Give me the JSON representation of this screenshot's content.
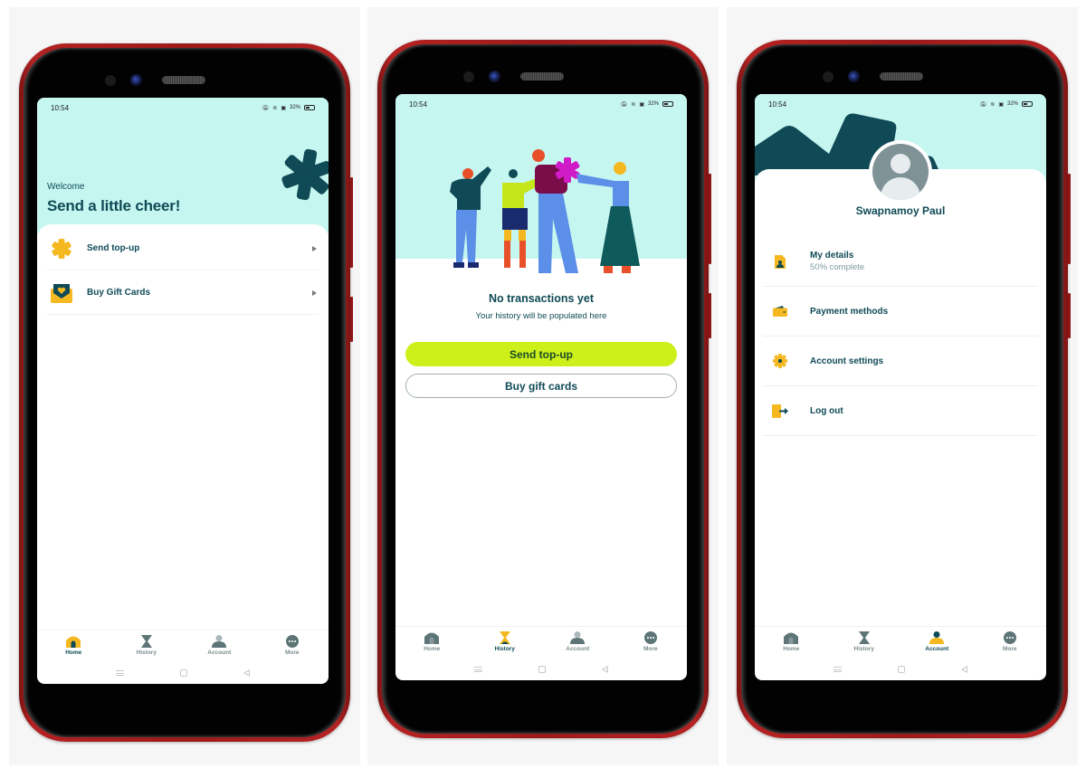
{
  "status_bar": {
    "time": "10:54",
    "battery": "32%"
  },
  "colors": {
    "mint": "#c6f6f0",
    "teal_dark": "#0f4a56",
    "accent_yellow": "#f5b820",
    "lime": "#cdf01a",
    "phone_red": "#a61c1c"
  },
  "home": {
    "welcome": "Welcome",
    "headline": "Send a little cheer!",
    "menu": [
      {
        "label": "Send top-up",
        "icon": "asterisk-icon"
      },
      {
        "label": "Buy Gift Cards",
        "icon": "gift-card-envelope-icon"
      }
    ]
  },
  "history": {
    "empty_title": "No transactions yet",
    "empty_subtitle": "Your history will be populated here",
    "primary_button": "Send top-up",
    "secondary_button": "Buy gift cards"
  },
  "account": {
    "user_name": "Swapnamoy Paul",
    "menu": [
      {
        "label": "My details",
        "sublabel": "50% complete",
        "icon": "id-document-icon",
        "completion_percent": 50
      },
      {
        "label": "Payment methods",
        "icon": "wallet-icon"
      },
      {
        "label": "Account settings",
        "icon": "gear-icon"
      },
      {
        "label": "Log out",
        "icon": "logout-icon"
      }
    ]
  },
  "nav": {
    "items": [
      {
        "label": "Home",
        "icon": "home-icon"
      },
      {
        "label": "History",
        "icon": "hourglass-icon"
      },
      {
        "label": "Account",
        "icon": "account-icon"
      },
      {
        "label": "More",
        "icon": "more-icon"
      }
    ]
  },
  "screens": [
    {
      "name": "home",
      "active_tab": "Home"
    },
    {
      "name": "history",
      "active_tab": "History"
    },
    {
      "name": "account",
      "active_tab": "Account"
    }
  ]
}
